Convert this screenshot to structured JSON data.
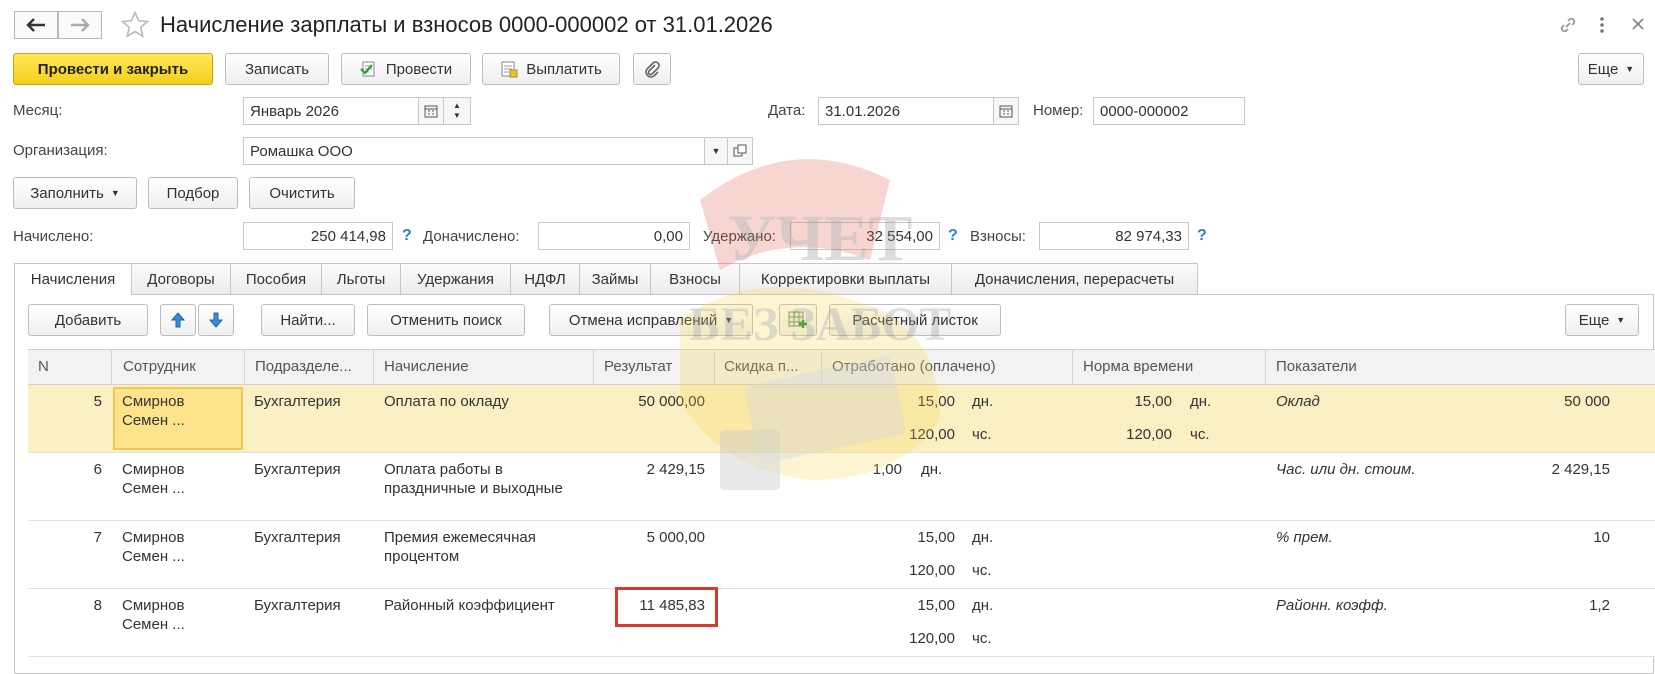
{
  "window": {
    "title": "Начисление зарплаты и взносов 0000-000002 от 31.01.2026"
  },
  "toolbar": {
    "post_close": "Провести и закрыть",
    "save": "Записать",
    "post": "Провести",
    "pay": "Выплатить",
    "more": "Еще"
  },
  "form": {
    "month_label": "Месяц:",
    "month_value": "Январь 2026",
    "date_label": "Дата:",
    "date_value": "31.01.2026",
    "number_label": "Номер:",
    "number_value": "0000-000002",
    "org_label": "Организация:",
    "org_value": "Ромашка ООО",
    "fill": "Заполнить",
    "pick": "Подбор",
    "clear": "Очистить"
  },
  "totals": {
    "accrued_label": "Начислено:",
    "accrued_value": "250 414,98",
    "extra_label": "Доначислено:",
    "extra_value": "0,00",
    "withheld_label": "Удержано:",
    "withheld_value": "32 554,00",
    "contrib_label": "Взносы:",
    "contrib_value": "82 974,33",
    "help": "?"
  },
  "tabs": [
    {
      "label": "Начисления",
      "active": true
    },
    {
      "label": "Договоры"
    },
    {
      "label": "Пособия"
    },
    {
      "label": "Льготы"
    },
    {
      "label": "Удержания"
    },
    {
      "label": "НДФЛ"
    },
    {
      "label": "Займы"
    },
    {
      "label": "Взносы"
    },
    {
      "label": "Корректировки выплаты"
    },
    {
      "label": "Доначисления, перерасчеты"
    }
  ],
  "table_toolbar": {
    "add": "Добавить",
    "find": "Найти...",
    "cancel_search": "Отменить поиск",
    "cancel_fix": "Отмена исправлений",
    "payslip": "Расчетный листок",
    "more": "Еще"
  },
  "columns": [
    "N",
    "Сотрудник",
    "Подразделе...",
    "Начисление",
    "Результат",
    "Скидка п...",
    "Отработано (оплачено)",
    "Норма времени",
    "Показатели"
  ],
  "rows": [
    {
      "n": "5",
      "emp1": "Смирнов",
      "emp2": "Семен ...",
      "dept": "Бухгалтерия",
      "acc1": "Оплата по окладу",
      "acc2": "",
      "result": "50 000,00",
      "worked1": "15,00",
      "unit1": "дн.",
      "worked2": "120,00",
      "unit2": "чс.",
      "norm1": "15,00",
      "nunit1": "дн.",
      "norm2": "120,00",
      "nunit2": "чс.",
      "ind": "Оклад",
      "ind_val": "50 000"
    },
    {
      "n": "6",
      "emp1": "Смирнов",
      "emp2": "Семен ...",
      "dept": "Бухгалтерия",
      "acc1": "Оплата работы в",
      "acc2": "праздничные и выходные",
      "result": "2 429,15",
      "worked1": "1,00",
      "unit1": "дн.",
      "worked2": "",
      "unit2": "",
      "norm1": "",
      "nunit1": "",
      "norm2": "",
      "nunit2": "",
      "ind": "Час. или дн. стоим.",
      "ind_val": "2 429,15"
    },
    {
      "n": "7",
      "emp1": "Смирнов",
      "emp2": "Семен ...",
      "dept": "Бухгалтерия",
      "acc1": "Премия ежемесячная",
      "acc2": "процентом",
      "result": "5 000,00",
      "worked1": "15,00",
      "unit1": "дн.",
      "worked2": "120,00",
      "unit2": "чс.",
      "norm1": "",
      "nunit1": "",
      "norm2": "",
      "nunit2": "",
      "ind": "% прем.",
      "ind_val": "10"
    },
    {
      "n": "8",
      "emp1": "Смирнов",
      "emp2": "Семен ...",
      "dept": "Бухгалтерия",
      "acc1": "Районный коэффициент",
      "acc2": "",
      "result": "11 485,83",
      "worked1": "15,00",
      "unit1": "дн.",
      "worked2": "120,00",
      "unit2": "чс.",
      "norm1": "",
      "nunit1": "",
      "norm2": "",
      "nunit2": "",
      "ind": "Районн. коэфф.",
      "ind_val": "1,2"
    }
  ],
  "watermark": {
    "line1": "УЧЕТ",
    "line2": "БЕЗ ЗАБОТ"
  },
  "colors": {
    "primary_button": "#f4cf1b",
    "selected_row": "#fbf0c4",
    "highlight_box": "#d23c32",
    "help_icon": "#2f7fc7"
  }
}
